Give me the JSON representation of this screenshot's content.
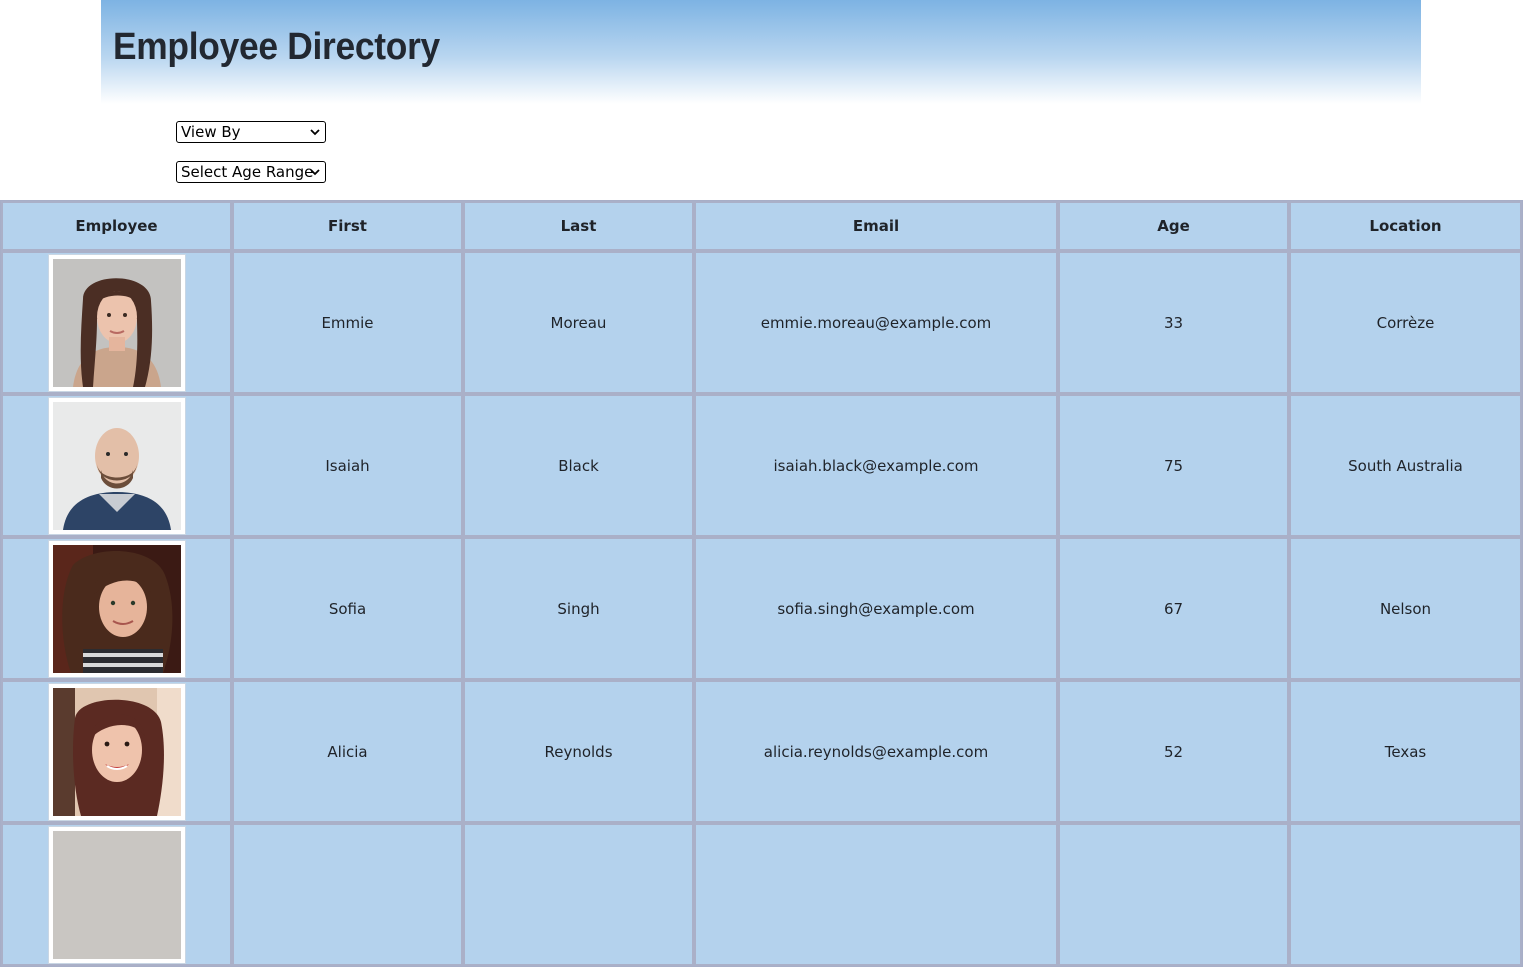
{
  "header": {
    "title": "Employee Directory"
  },
  "controls": {
    "view_by": "View By",
    "age_range": "Select Age Range"
  },
  "table": {
    "columns": [
      "Employee",
      "First",
      "Last",
      "Email",
      "Age",
      "Location"
    ],
    "rows": [
      {
        "first": "Emmie",
        "last": "Moreau",
        "email": "emmie.moreau@example.com",
        "age": "33",
        "location": "Corrèze"
      },
      {
        "first": "Isaiah",
        "last": "Black",
        "email": "isaiah.black@example.com",
        "age": "75",
        "location": "South Australia"
      },
      {
        "first": "Sofia",
        "last": "Singh",
        "email": "sofia.singh@example.com",
        "age": "67",
        "location": "Nelson"
      },
      {
        "first": "Alicia",
        "last": "Reynolds",
        "email": "alicia.reynolds@example.com",
        "age": "52",
        "location": "Texas"
      },
      {
        "first": "",
        "last": "",
        "email": "",
        "age": "",
        "location": ""
      }
    ]
  },
  "colors": {
    "header_gradient_top": "#7db3e3",
    "table_background": "#b4d2ed",
    "table_border": "#aab0c8"
  },
  "icons": [
    "chevron-down-icon",
    "employee-photo"
  ]
}
